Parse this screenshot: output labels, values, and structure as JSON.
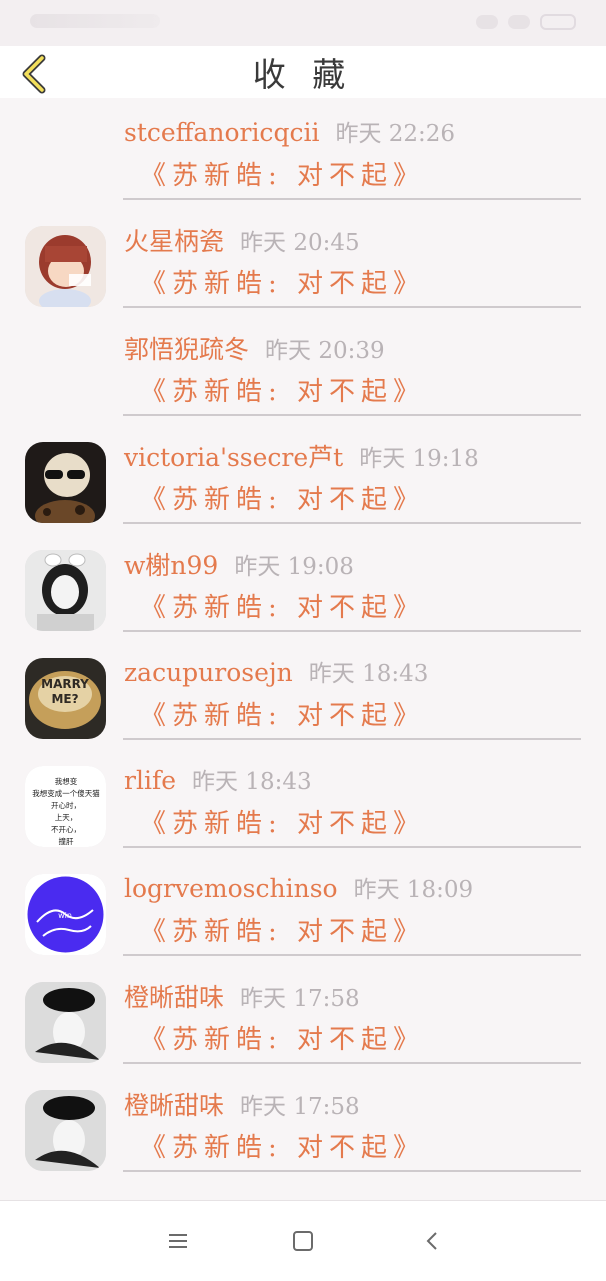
{
  "header": {
    "title": "收 藏"
  },
  "items": [
    {
      "name": "stceffanoricqcii",
      "time": "昨天 22:26",
      "song": "《苏新皓: 对不起》",
      "avatar": "none"
    },
    {
      "name": "火星柄瓷",
      "time": "昨天 20:45",
      "song": "《苏新皓: 对不起》",
      "avatar": "girl-hair-bob"
    },
    {
      "name": "郭悟猊疏冬",
      "time": "昨天 20:39",
      "song": "《苏新皓: 对不起》",
      "avatar": "none"
    },
    {
      "name": "victoria'ssecre芦t",
      "time": "昨天 19:18",
      "song": "《苏新皓: 对不起》",
      "avatar": "blonde-sunglasses"
    },
    {
      "name": "w榭n99",
      "time": "昨天 19:08",
      "song": "《苏新皓: 对不起》",
      "avatar": "girl-bunny-ears"
    },
    {
      "name": "zacupurosejn",
      "time": "昨天 18:43",
      "song": "《苏新皓: 对不起》",
      "avatar": "marry-me-cup"
    },
    {
      "name": "rlife",
      "time": "昨天 18:43",
      "song": "《苏新皓: 对不起》",
      "avatar": "text-quote"
    },
    {
      "name": "logrvemoschinso",
      "time": "昨天 18:09",
      "song": "《苏新皓: 对不起》",
      "avatar": "purple-circle"
    },
    {
      "name": "橙晰甜味",
      "time": "昨天 17:58",
      "song": "《苏新皓: 对不起》",
      "avatar": "hat-girl"
    },
    {
      "name": "橙晰甜味",
      "time": "昨天 17:58",
      "song": "《苏新皓: 对不起》",
      "avatar": "hat-girl"
    }
  ],
  "avatar_text": {
    "marry_me": "MARRY\nME?",
    "quote_lines": [
      "我想变",
      "我想变成一个傻天猫",
      "开心时，",
      "上天，",
      "不开心，",
      "撞肝"
    ]
  },
  "navbar": {
    "menu_icon": "menu-icon",
    "home_icon": "home-square-icon",
    "back_icon": "back-triangle-icon"
  },
  "colors": {
    "accent": "#e47a4d",
    "time": "#b9b3b6",
    "divider": "#cfcacd"
  }
}
